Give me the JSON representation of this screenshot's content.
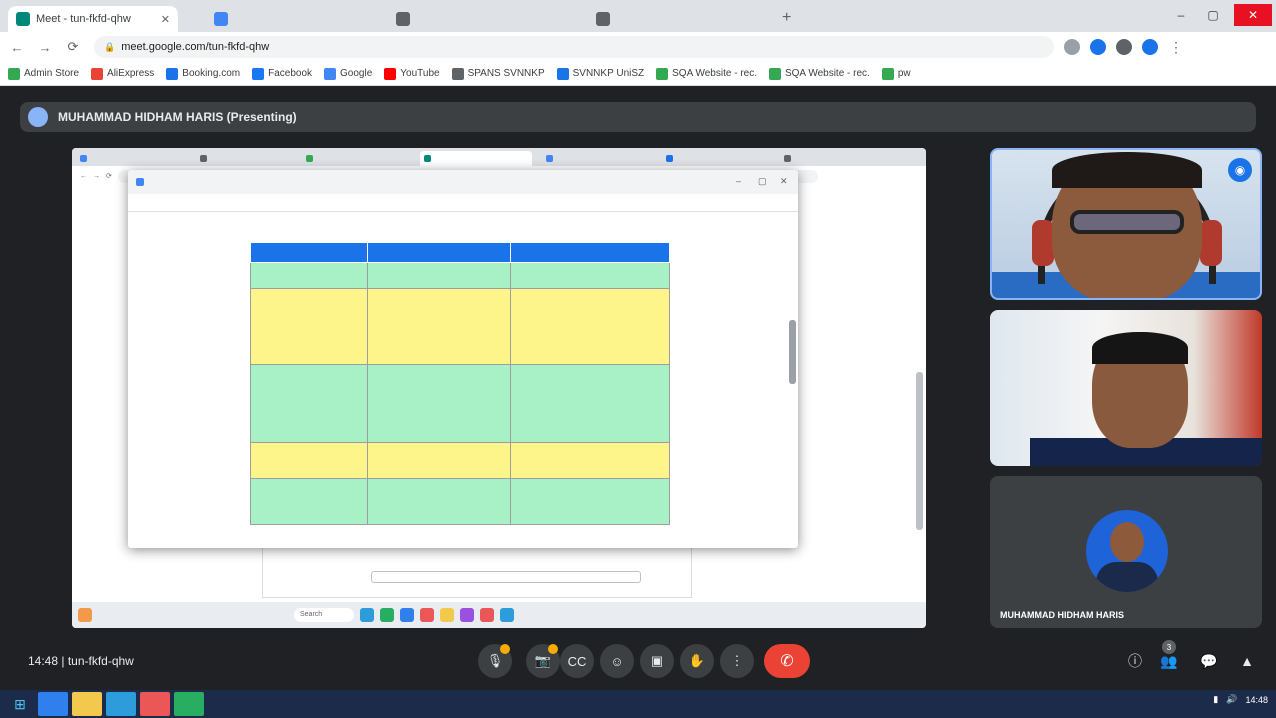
{
  "browser": {
    "tabs": [
      {
        "title": "Meet - tun-fkfd-qhw",
        "active": true,
        "color": "#00897b"
      },
      {
        "title": "",
        "active": false,
        "color": "#4285f4"
      },
      {
        "title": "",
        "active": false,
        "color": "#5f6368"
      },
      {
        "title": "",
        "active": false,
        "color": "#5f6368"
      }
    ],
    "new_tab": "+",
    "url": "meet.google.com/tun-fkfd-qhw",
    "window_controls": [
      "–",
      "▢",
      "✕"
    ]
  },
  "bookmarks": [
    {
      "label": "Admin Store",
      "color": "#34a853"
    },
    {
      "label": "AliExpress",
      "color": "#ea4335"
    },
    {
      "label": "Booking.com",
      "color": "#1a73e8"
    },
    {
      "label": "Facebook",
      "color": "#1877f2"
    },
    {
      "label": "Google",
      "color": "#4285f4"
    },
    {
      "label": "YouTube",
      "color": "#ff0000"
    },
    {
      "label": "SPANS SVNNKP",
      "color": "#5f6368"
    },
    {
      "label": "SVNNKP UniSZ",
      "color": "#1a73e8"
    },
    {
      "label": "SQA Website - rec.",
      "color": "#34a853"
    },
    {
      "label": "SQA Website - rec.",
      "color": "#34a853"
    },
    {
      "label": "pw",
      "color": "#34a853"
    }
  ],
  "presenter": {
    "label": "MUHAMMAD HIDHAM HARIS (Presenting)"
  },
  "shared": {
    "inner_tabs": [
      "",
      "",
      "",
      "",
      "",
      "",
      ""
    ],
    "popup_title": "",
    "popup_url": "",
    "heading": "",
    "table": {
      "headers": [
        "",
        "",
        ""
      ],
      "rows": [
        {
          "color": "green",
          "col1": "",
          "col2": "",
          "col3": ""
        },
        {
          "color": "yellow",
          "col1": "",
          "col2": "",
          "col3": ""
        },
        {
          "color": "green",
          "col1": "",
          "col2": "",
          "col3": ""
        },
        {
          "color": "yellow",
          "col1": "",
          "col2": "",
          "col3": ""
        },
        {
          "color": "green",
          "col1": "",
          "col2": "",
          "col3": ""
        }
      ]
    },
    "search_placeholder": "Search"
  },
  "participants": [
    {
      "name": "",
      "speaking": true
    },
    {
      "name": "",
      "speaking": false
    },
    {
      "name": "MUHAMMAD HIDHAM HARIS",
      "speaking": false
    }
  ],
  "callbar": {
    "meeting_info": "14:48 | tun-fkfd-qhw",
    "buttons": [
      {
        "icon": "mic-off-icon",
        "glyph": "🎙",
        "alert": true
      },
      {
        "icon": "camera-off-icon",
        "glyph": "📷",
        "alert": true
      },
      {
        "icon": "captions-icon",
        "glyph": "CC",
        "alert": false
      },
      {
        "icon": "emoji-icon",
        "glyph": "☺",
        "alert": false
      },
      {
        "icon": "present-icon",
        "glyph": "▣",
        "alert": false
      },
      {
        "icon": "raise-hand-icon",
        "glyph": "✋",
        "alert": false
      },
      {
        "icon": "more-options-icon",
        "glyph": "⋮",
        "alert": false
      }
    ],
    "end_call_glyph": "✆",
    "right": [
      {
        "icon": "info-icon",
        "glyph": "ⓘ"
      },
      {
        "icon": "people-icon",
        "glyph": "👥"
      },
      {
        "icon": "chat-icon",
        "glyph": "💬"
      },
      {
        "icon": "activities-icon",
        "glyph": "▲"
      }
    ],
    "people_count": "3"
  },
  "taskbar": {
    "apps": [
      "#2f80ed",
      "#f2c94c",
      "#2d9cdb",
      "#eb5757",
      "#27ae60"
    ],
    "tray_time": "14:48",
    "tray_date": ""
  }
}
